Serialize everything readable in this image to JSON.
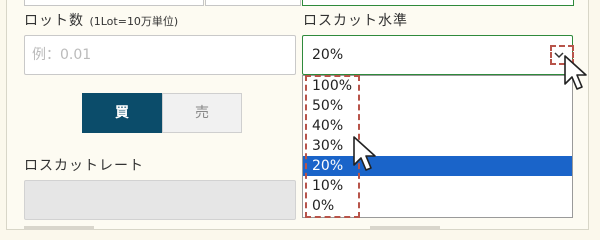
{
  "lot": {
    "label": "ロット数",
    "label_note": "(1Lot=10万単位)",
    "placeholder": "例：0.01"
  },
  "losscut": {
    "label": "ロスカット水準",
    "selected": "20%",
    "options": [
      "100%",
      "50%",
      "40%",
      "30%",
      "20%",
      "10%",
      "0%"
    ]
  },
  "trade": {
    "buy_label": "買",
    "sell_label": "売"
  },
  "losscut_rate": {
    "label": "ロスカットレート"
  },
  "colors": {
    "accent_green": "#2f8a3c",
    "buy_bg": "#0b4c6a",
    "highlight": "#1a64c9",
    "dash": "#b8544a"
  },
  "icons": [
    "chevron-down-icon",
    "mouse-pointer-icon"
  ]
}
